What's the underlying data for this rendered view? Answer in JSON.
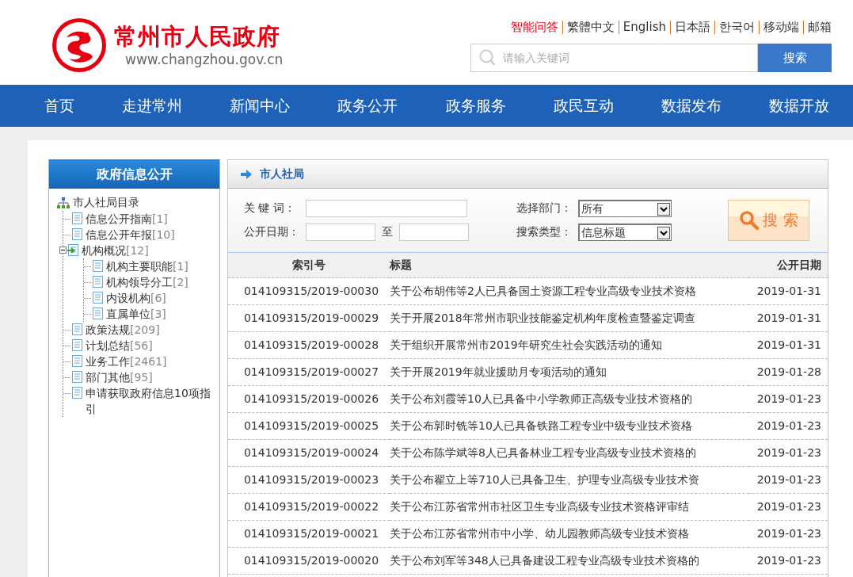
{
  "header": {
    "site_title": "常州市人民政府",
    "site_url": "www.changzhou.gov.cn",
    "top_links": [
      {
        "label": "智能问答",
        "selected": true
      },
      {
        "label": "繁體中文",
        "selected": false
      },
      {
        "label": "English",
        "selected": false
      },
      {
        "label": "日本語",
        "selected": false
      },
      {
        "label": "한국어",
        "selected": false
      },
      {
        "label": "移动端",
        "selected": false
      },
      {
        "label": "邮箱",
        "selected": false
      }
    ],
    "search": {
      "placeholder": "请输入关键词",
      "button": "搜索"
    }
  },
  "nav": [
    "首页",
    "走进常州",
    "新闻中心",
    "政务公开",
    "政务服务",
    "政民互动",
    "数据发布",
    "数据开放"
  ],
  "sidebar": {
    "title": "政府信息公开",
    "root": "市人社局目录",
    "items": [
      {
        "label": "信息公开指南",
        "count": "[1]"
      },
      {
        "label": "信息公开年报",
        "count": "[10]"
      },
      {
        "label": "机构概况",
        "count": "[12]",
        "expanded": true,
        "children": [
          {
            "label": "机构主要职能",
            "count": "[1]"
          },
          {
            "label": "机构领导分工",
            "count": "[2]"
          },
          {
            "label": "内设机构",
            "count": "[6]"
          },
          {
            "label": "直属单位",
            "count": "[3]"
          }
        ]
      },
      {
        "label": "政策法规",
        "count": "[209]"
      },
      {
        "label": "计划总结",
        "count": "[56]"
      },
      {
        "label": "业务工作",
        "count": "[2461]"
      },
      {
        "label": "部门其他",
        "count": "[95]"
      },
      {
        "label": "申请获取政府信息10项指引"
      }
    ]
  },
  "panel": {
    "title": "市人社局",
    "filters": {
      "keyword_label": "关 键 词：",
      "date_label": "公开日期：",
      "date_to": "至",
      "dept_label": "选择部门：",
      "dept_value": "所有",
      "type_label": "搜索类型：",
      "type_value": "信息标题",
      "button": "搜 索"
    },
    "table": {
      "columns": [
        "索引号",
        "标题",
        "公开日期"
      ],
      "rows": [
        [
          "014109315/2019-00030",
          "关于公布胡伟等2人已具备国土资源工程专业高级专业技术资格",
          "2019-01-31"
        ],
        [
          "014109315/2019-00029",
          "关于开展2018年常州市职业技能鉴定机构年度检查暨鉴定调查",
          "2019-01-31"
        ],
        [
          "014109315/2019-00028",
          "关于组织开展常州市2019年研究生社会实践活动的通知",
          "2019-01-31"
        ],
        [
          "014109315/2019-00027",
          "关于开展2019年就业援助月专项活动的通知",
          "2019-01-28"
        ],
        [
          "014109315/2019-00026",
          "关于公布刘霞等10人已具备中小学教师正高级专业技术资格的",
          "2019-01-23"
        ],
        [
          "014109315/2019-00025",
          "关于公布郭时铣等10人已具备铁路工程专业中级专业技术资格",
          "2019-01-23"
        ],
        [
          "014109315/2019-00024",
          "关于公布陈学斌等8人已具备林业工程专业高级专业技术资格的",
          "2019-01-23"
        ],
        [
          "014109315/2019-00023",
          "关于公布翟立上等710人已具备卫生、护理专业高级专业技术资",
          "2019-01-23"
        ],
        [
          "014109315/2019-00022",
          "关于公布江苏省常州市社区卫生专业高级专业技术资格评审结",
          "2019-01-23"
        ],
        [
          "014109315/2019-00021",
          "关于公布江苏省常州市中小学、幼儿园教师高级专业技术资格",
          "2019-01-23"
        ],
        [
          "014109315/2019-00020",
          "关于公布刘军等348人已具备建设工程专业高级专业技术资格的",
          "2019-01-23"
        ]
      ]
    }
  }
}
